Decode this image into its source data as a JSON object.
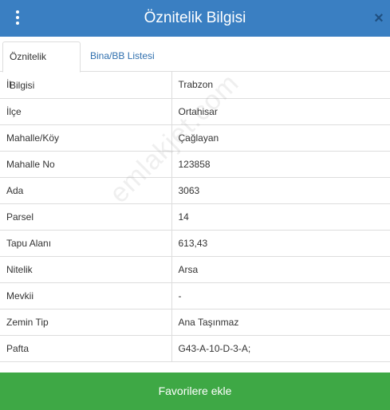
{
  "header": {
    "title": "Öznitelik Bilgisi",
    "close_label": "×"
  },
  "tabs": [
    {
      "label": "Öznitelik Bilgisi",
      "active": true
    },
    {
      "label": "Bina/BB Listesi",
      "active": false
    }
  ],
  "rows": [
    {
      "key": "İl",
      "value": "Trabzon"
    },
    {
      "key": "İlçe",
      "value": "Ortahisar"
    },
    {
      "key": "Mahalle/Köy",
      "value": "Çağlayan"
    },
    {
      "key": "Mahalle No",
      "value": "123858"
    },
    {
      "key": "Ada",
      "value": "3063"
    },
    {
      "key": "Parsel",
      "value": "14"
    },
    {
      "key": "Tapu Alanı",
      "value": "613,43"
    },
    {
      "key": "Nitelik",
      "value": "Arsa"
    },
    {
      "key": "Mevkii",
      "value": "-"
    },
    {
      "key": "Zemin Tip",
      "value": "Ana Taşınmaz"
    },
    {
      "key": "Pafta",
      "value": "G43-A-10-D-3-A;"
    }
  ],
  "watermark": "emlakjet.com",
  "footer": {
    "favorite_label": "Favorilere ekle"
  },
  "colors": {
    "header_bg": "#3a7fc2",
    "button_bg": "#3ea845",
    "link": "#2f6fae"
  },
  "icons": {
    "menu": "vertical-dots-icon",
    "close": "close-icon"
  }
}
